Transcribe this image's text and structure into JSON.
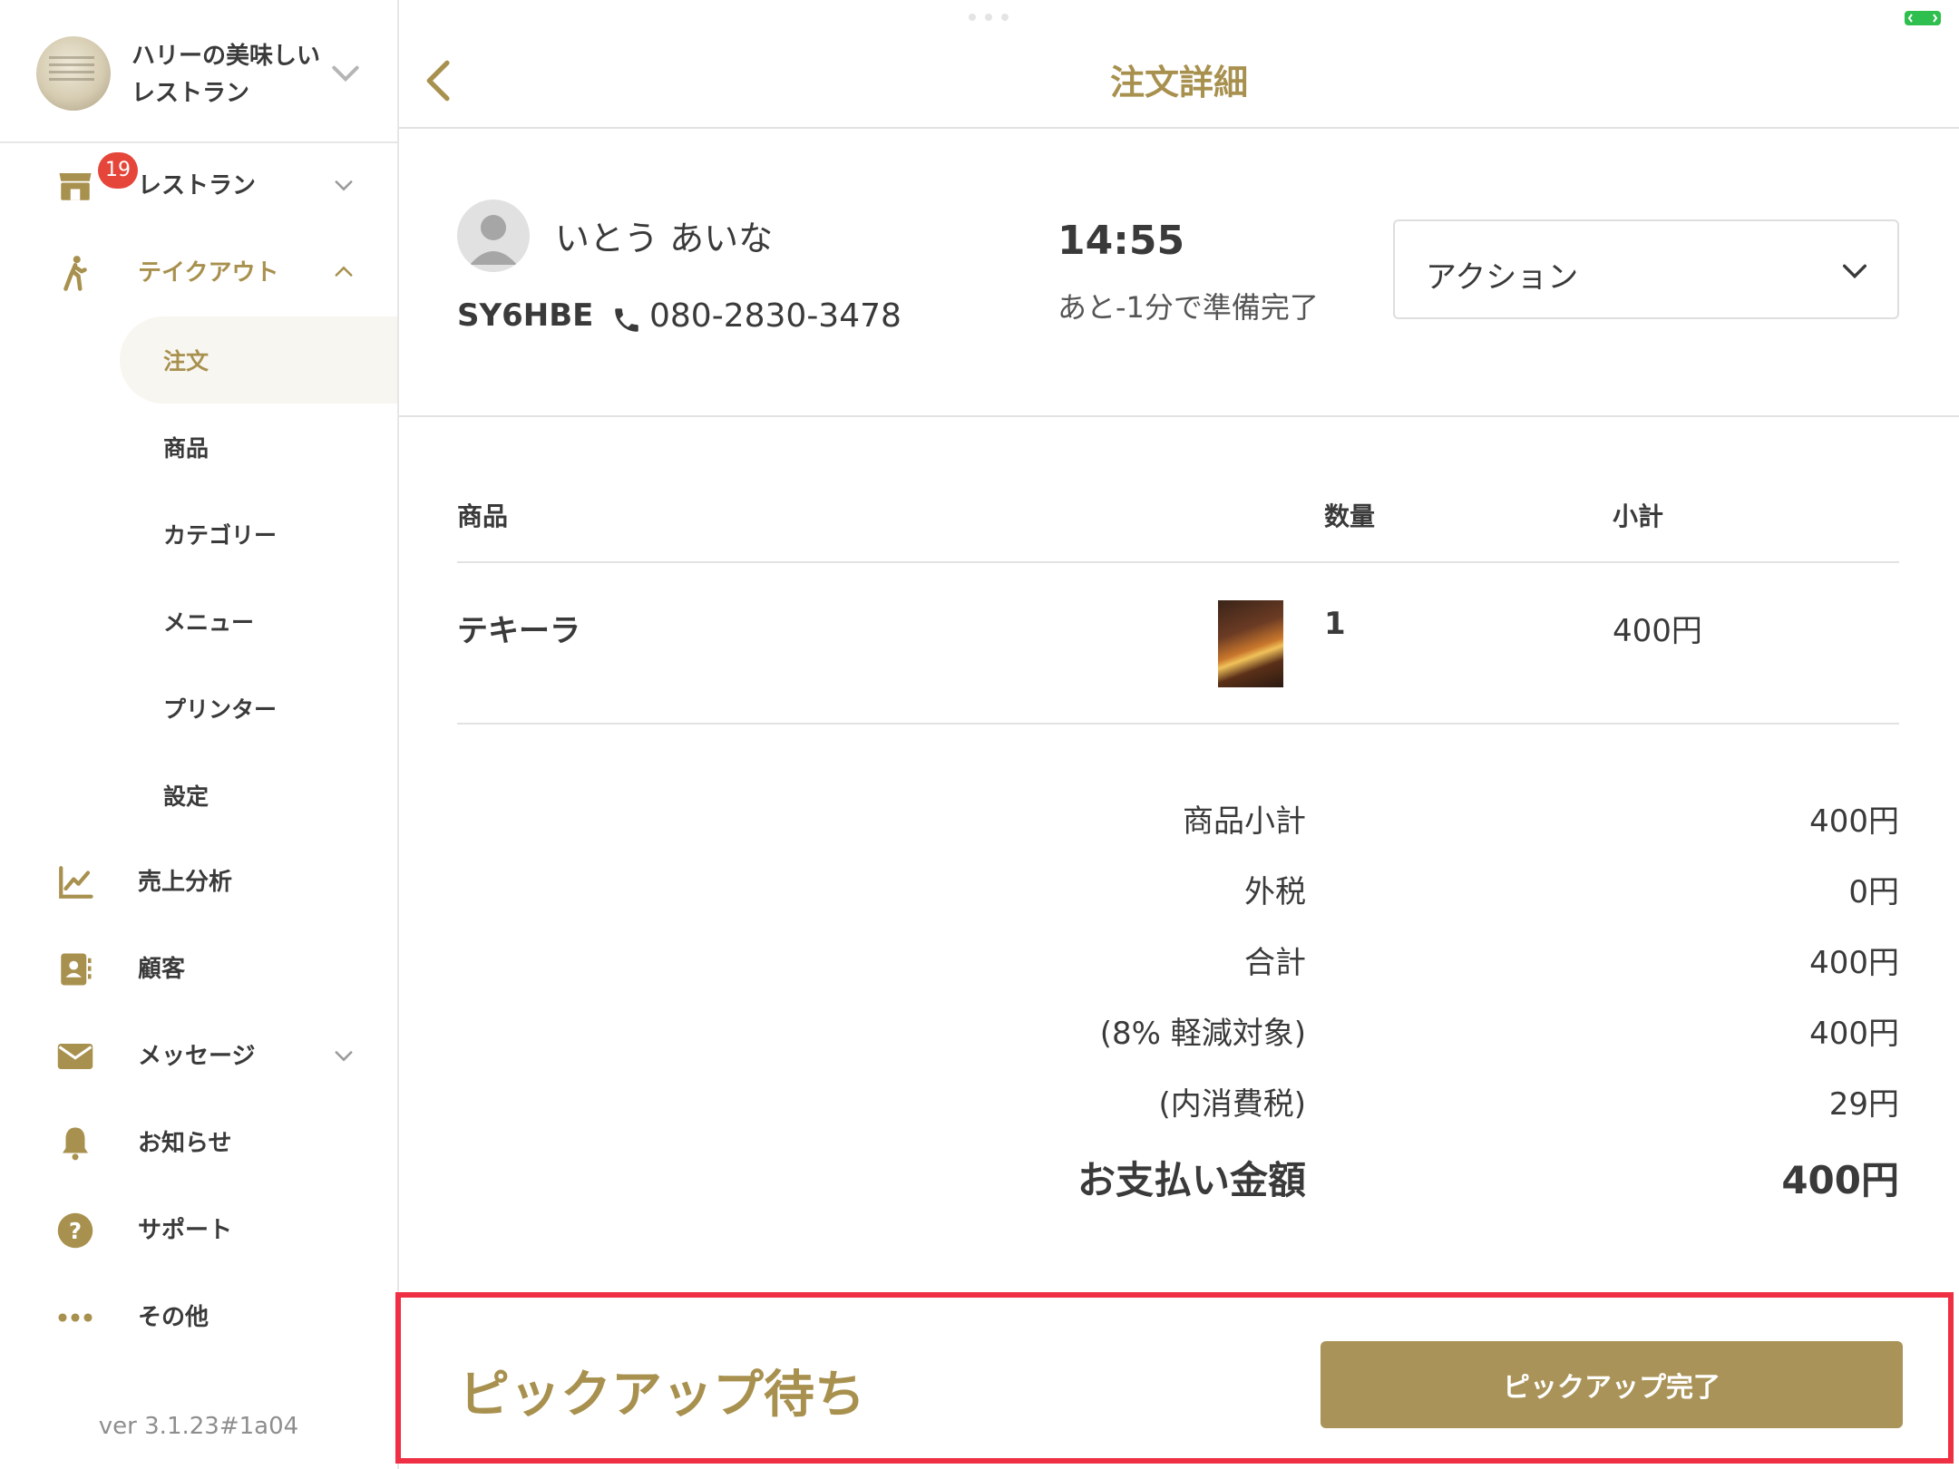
{
  "sidebar": {
    "restaurant_name_line1": "ハリーの美味しい",
    "restaurant_name_line2": "レストラン",
    "items": [
      {
        "label": "レストラン",
        "badge": "19"
      },
      {
        "label": "テイクアウト"
      },
      {
        "label": "売上分析"
      },
      {
        "label": "顧客"
      },
      {
        "label": "メッセージ"
      },
      {
        "label": "お知らせ"
      },
      {
        "label": "サポート"
      },
      {
        "label": "その他"
      }
    ],
    "takeout_subitems": [
      "注文",
      "商品",
      "カテゴリー",
      "メニュー",
      "プリンター",
      "設定"
    ],
    "version": "ver 3.1.23#1a04"
  },
  "header": {
    "title": "注文詳細"
  },
  "customer": {
    "name": "いとう あいな",
    "order_code": "SY6HBE",
    "phone": "080-2830-3478",
    "pickup_time": "14:55",
    "ready_text": "あと-1分で準備完了",
    "action_label": "アクション"
  },
  "table": {
    "headers": {
      "product": "商品",
      "quantity": "数量",
      "subtotal": "小計"
    },
    "rows": [
      {
        "name": "テキーラ",
        "quantity": "1",
        "subtotal": "400円"
      }
    ]
  },
  "summary": [
    {
      "label": "商品小計",
      "value": "400円"
    },
    {
      "label": "外税",
      "value": "0円"
    },
    {
      "label": "合計",
      "value": "400円"
    },
    {
      "label": "(8% 軽減対象)",
      "value": "400円"
    },
    {
      "label": "(内消費税)",
      "value": "29円"
    }
  ],
  "payment": {
    "label": "お支払い金額",
    "value": "400円"
  },
  "footer": {
    "status": "ピックアップ待ち",
    "complete_button": "ピックアップ完了"
  },
  "colors": {
    "accent": "#a8914f",
    "button": "#aa9358",
    "badge": "#e6453a",
    "highlight": "#ee2f44"
  }
}
